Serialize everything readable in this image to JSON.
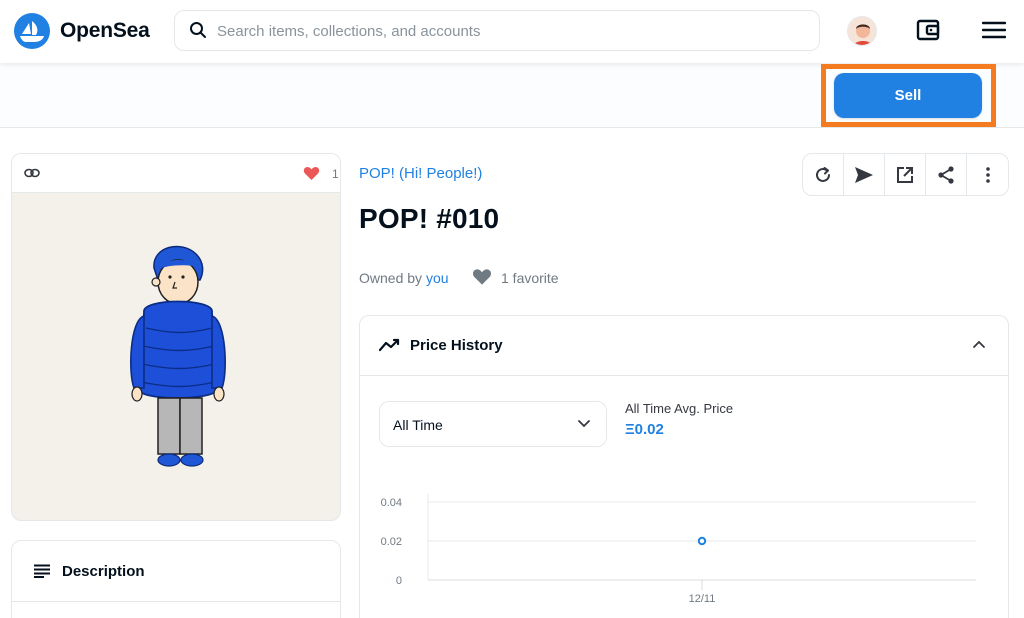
{
  "header": {
    "brand": "OpenSea",
    "search_placeholder": "Search items, collections, and accounts"
  },
  "toolbar": {
    "sell_label": "Sell"
  },
  "asset": {
    "favorite_count": "1",
    "collection": "POP! (Hi! People!)",
    "title": "POP! #010",
    "owned_by_prefix": "Owned by",
    "owner": "you",
    "favorites_text": "1 favorite"
  },
  "description": {
    "title": "Description"
  },
  "price_history": {
    "title": "Price History",
    "time_filter": "All Time",
    "avg_label": "All Time Avg. Price",
    "avg_value": "Ξ0.02"
  },
  "chart_data": {
    "type": "scatter",
    "title": "",
    "xlabel": "",
    "ylabel": "",
    "categories": [
      "12/11"
    ],
    "values": [
      0.02
    ],
    "y_ticks": [
      "0.04",
      "0.02",
      "0"
    ],
    "ylim": [
      0,
      0.04
    ],
    "grid": true
  },
  "colors": {
    "accent": "#2081e2",
    "highlight": "#f47b20",
    "heart_red": "#eb5757"
  }
}
